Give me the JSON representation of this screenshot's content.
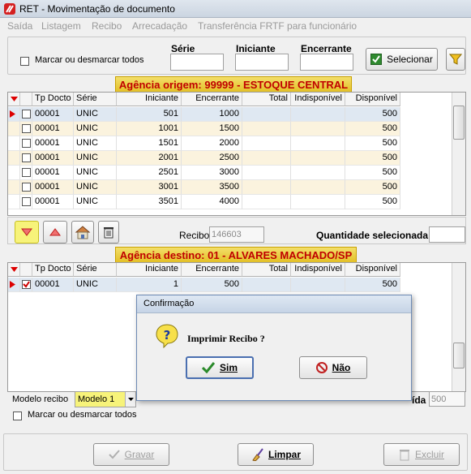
{
  "window": {
    "title": "RET - Movimentação de documento"
  },
  "menu": [
    "Saída",
    "Listagem",
    "Recibo",
    "Arrecadação",
    "Transferência FRTF para funcionário"
  ],
  "filter": {
    "mark_all_label": "Marcar ou desmarcar todos",
    "serie_label": "Série",
    "iniciante_label": "Iniciante",
    "encerrante_label": "Encerrante",
    "serie_value": "",
    "iniciante_value": "",
    "encerrante_value": "",
    "select_button": "Selecionar"
  },
  "origin": {
    "banner": "Agência origem: 99999 - ESTOQUE CENTRAL",
    "columns": [
      "Tp Docto",
      "Série",
      "Iniciante",
      "Encerrante",
      "Total",
      "Indisponível",
      "Disponível"
    ],
    "rows": [
      {
        "tp": "00001",
        "serie": "UNIC",
        "ini": "501",
        "enc": "1000",
        "total": "",
        "indisp": "",
        "disp": "500"
      },
      {
        "tp": "00001",
        "serie": "UNIC",
        "ini": "1001",
        "enc": "1500",
        "total": "",
        "indisp": "",
        "disp": "500"
      },
      {
        "tp": "00001",
        "serie": "UNIC",
        "ini": "1501",
        "enc": "2000",
        "total": "",
        "indisp": "",
        "disp": "500"
      },
      {
        "tp": "00001",
        "serie": "UNIC",
        "ini": "2001",
        "enc": "2500",
        "total": "",
        "indisp": "",
        "disp": "500"
      },
      {
        "tp": "00001",
        "serie": "UNIC",
        "ini": "2501",
        "enc": "3000",
        "total": "",
        "indisp": "",
        "disp": "500"
      },
      {
        "tp": "00001",
        "serie": "UNIC",
        "ini": "3001",
        "enc": "3500",
        "total": "",
        "indisp": "",
        "disp": "500"
      },
      {
        "tp": "00001",
        "serie": "UNIC",
        "ini": "3501",
        "enc": "4000",
        "total": "",
        "indisp": "",
        "disp": "500"
      }
    ]
  },
  "transfer": {
    "recibo_label": "Recibo",
    "recibo_value": "146603",
    "qty_label": "Quantidade selecionada",
    "qty_value": ""
  },
  "dest": {
    "banner": "Agência destino: 01 - ALVARES MACHADO/SP",
    "columns": [
      "Tp Docto",
      "Série",
      "Iniciante",
      "Encerrante",
      "Total",
      "Indisponível",
      "Disponível"
    ],
    "rows": [
      {
        "tp": "00001",
        "serie": "UNIC",
        "ini": "1",
        "enc": "500",
        "total": "",
        "indisp": "",
        "disp": "500"
      }
    ]
  },
  "bottom": {
    "modelo_label": "Modelo recibo",
    "modelo_value": "Modelo 1",
    "saida_label_partial": "ída",
    "saida_value": "500",
    "mark_all_label": "Marcar ou desmarcar todos"
  },
  "actions": {
    "gravar": "Gravar",
    "limpar": "Limpar",
    "excluir": "Excluir"
  },
  "dialog": {
    "title": "Confirmação",
    "message": "Imprimir Recibo ?",
    "yes": "Sim",
    "no": "Não"
  }
}
